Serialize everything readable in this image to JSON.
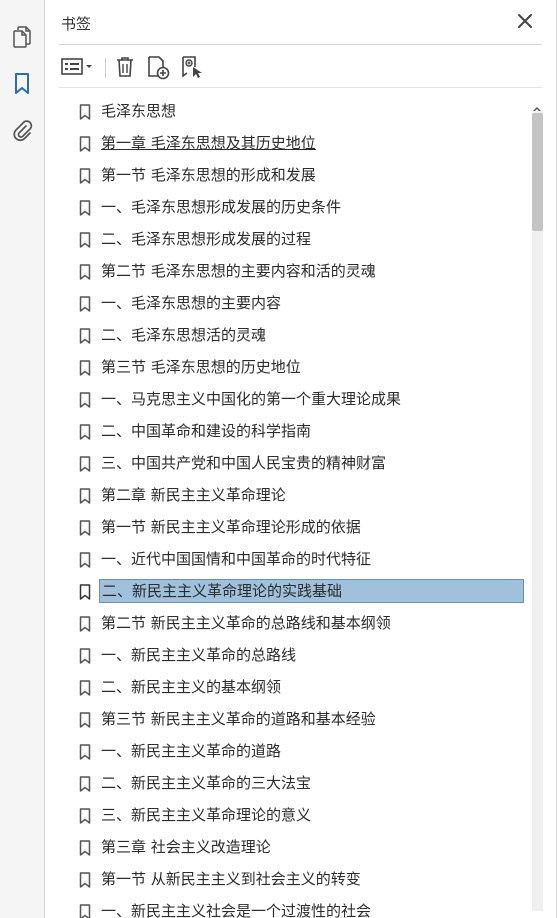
{
  "panel": {
    "title": "书签"
  },
  "rail": {
    "items": [
      {
        "name": "pages-icon",
        "active": false
      },
      {
        "name": "bookmark-icon",
        "active": true
      },
      {
        "name": "attachment-icon",
        "active": false
      }
    ]
  },
  "toolbar": {
    "items": [
      "options-menu-icon",
      "delete-icon",
      "new-bookmark-icon",
      "bookmark-from-selection-icon"
    ]
  },
  "colors": {
    "accent": "#2b6cb0",
    "selection": "#9fc1dc",
    "text": "#2b2b2b"
  },
  "bookmarks": [
    {
      "label": "毛泽东思想"
    },
    {
      "label": "第一章  毛泽东思想及其历史地位",
      "underline": true
    },
    {
      "label": "第一节  毛泽东思想的形成和发展"
    },
    {
      "label": "一、毛泽东思想形成发展的历史条件"
    },
    {
      "label": "二、毛泽东思想形成发展的过程"
    },
    {
      "label": "第二节  毛泽东思想的主要内容和活的灵魂"
    },
    {
      "label": "一、毛泽东思想的主要内容"
    },
    {
      "label": "二、毛泽东思想活的灵魂"
    },
    {
      "label": "第三节  毛泽东思想的历史地位"
    },
    {
      "label": "一、马克思主义中国化的第一个重大理论成果"
    },
    {
      "label": "二、中国革命和建设的科学指南"
    },
    {
      "label": "三、中国共产党和中国人民宝贵的精神财富"
    },
    {
      "label": "第二章  新民主主义革命理论"
    },
    {
      "label": "第一节  新民主主义革命理论形成的依据"
    },
    {
      "label": "一、近代中国国情和中国革命的时代特征"
    },
    {
      "label": "二、新民主主义革命理论的实践基础",
      "selected": true
    },
    {
      "label": "第二节  新民主主义革命的总路线和基本纲领"
    },
    {
      "label": "一、新民主主义革命的总路线"
    },
    {
      "label": "二、新民主主义的基本纲领"
    },
    {
      "label": "第三节  新民主主义革命的道路和基本经验"
    },
    {
      "label": "一、新民主主义革命的道路"
    },
    {
      "label": "二、新民主主义革命的三大法宝"
    },
    {
      "label": "三、新民主主义革命理论的意义"
    },
    {
      "label": "第三章  社会主义改造理论"
    },
    {
      "label": "第一节  从新民主主义到社会主义的转变"
    },
    {
      "label": "一、新民主主义社会是一个过渡性的社会"
    }
  ]
}
